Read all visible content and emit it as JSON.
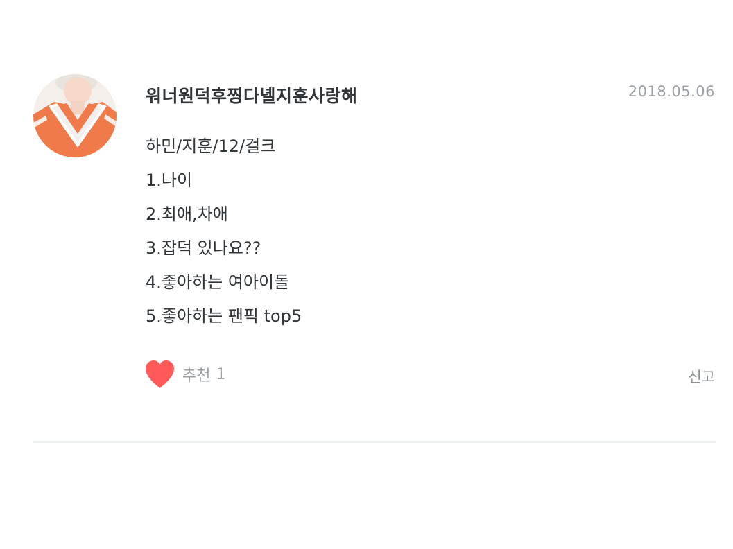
{
  "post": {
    "author": "워너원덕후찡다녤지훈사랑해",
    "date": "2018.05.06",
    "avatar_icon": "profile-photo",
    "lines": [
      "하민/지훈/12/걸크",
      "1.나이",
      "2.최애,차애",
      "3.잡덕 있나요??",
      "4.좋아하는 여아이돌",
      "5.좋아하는 팬픽 top5"
    ],
    "like_label": "추천",
    "like_count": "1",
    "report_label": "신고"
  },
  "colors": {
    "heart": "#ff5a5a",
    "muted_text": "#9aa0a5",
    "divider": "#e8ecee"
  }
}
